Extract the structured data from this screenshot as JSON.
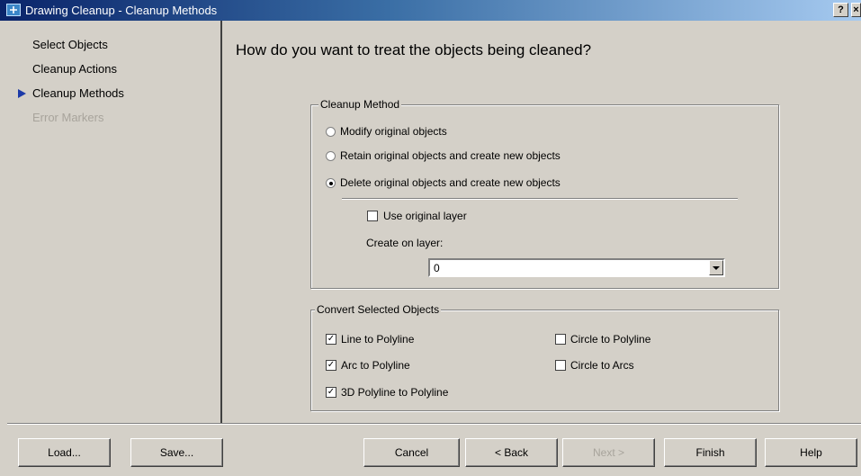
{
  "window": {
    "title": "Drawing Cleanup - Cleanup Methods",
    "help_button": "?",
    "close_button": "×"
  },
  "nav": {
    "items": [
      {
        "label": "Select Objects",
        "state": "normal"
      },
      {
        "label": "Cleanup Actions",
        "state": "normal"
      },
      {
        "label": "Cleanup Methods",
        "state": "current"
      },
      {
        "label": "Error Markers",
        "state": "disabled"
      }
    ]
  },
  "main": {
    "heading": "How do you want to treat the objects being cleaned?",
    "cleanup_method": {
      "legend": "Cleanup Method",
      "options": [
        {
          "label": "Modify original objects",
          "selected": false
        },
        {
          "label": "Retain original objects and create new objects",
          "selected": false
        },
        {
          "label": "Delete original objects and create new objects",
          "selected": true
        }
      ],
      "use_original_layer": {
        "label": "Use original layer",
        "checked": false
      },
      "create_on_layer_label": "Create on layer:",
      "layer_value": "0"
    },
    "convert_selected": {
      "legend": "Convert Selected Objects",
      "items": [
        {
          "label": "Line to Polyline",
          "checked": true
        },
        {
          "label": "Arc to Polyline",
          "checked": true
        },
        {
          "label": "3D Polyline to Polyline",
          "checked": true
        },
        {
          "label": "Circle to Polyline",
          "checked": false
        },
        {
          "label": "Circle to Arcs",
          "checked": false
        }
      ]
    }
  },
  "buttons": {
    "load": "Load...",
    "save": "Save...",
    "cancel": "Cancel",
    "back": "< Back",
    "next": "Next >",
    "finish": "Finish",
    "help": "Help"
  },
  "colors": {
    "face": "#d4d0c8",
    "titlebar_start": "#0a246a",
    "titlebar_end": "#a6caf0",
    "nav_arrow": "#1c3aa8",
    "disabled_text": "#a8a49c"
  }
}
